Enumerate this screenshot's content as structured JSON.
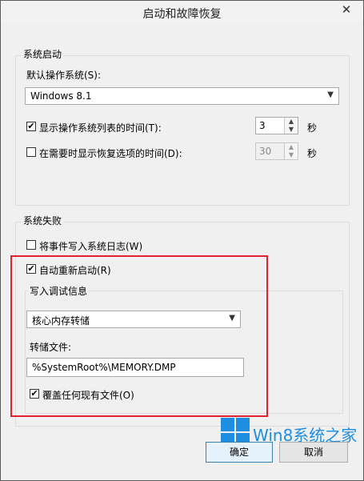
{
  "window": {
    "title": "启动和故障恢复",
    "close_glyph": "✕"
  },
  "system_startup": {
    "group_label": "系统启动",
    "default_os_label": "默认操作系统(S):",
    "default_os_value": "Windows 8.1",
    "show_os_list_label": "显示操作系统列表的时间(T):",
    "show_os_list_checked": true,
    "show_os_list_value": "3",
    "show_os_list_unit": "秒",
    "show_recovery_label": "在需要时显示恢复选项的时间(D):",
    "show_recovery_checked": false,
    "show_recovery_value": "30",
    "show_recovery_unit": "秒"
  },
  "system_failure": {
    "group_label": "系统失败",
    "write_event_label": "将事件写入系统日志(W)",
    "write_event_checked": false,
    "auto_restart_label": "自动重新启动(R)",
    "auto_restart_checked": true,
    "debug_group_label": "写入调试信息",
    "debug_type_value": "核心内存转储",
    "dump_file_label": "转储文件:",
    "dump_file_value": "%SystemRoot%\\MEMORY.DMP",
    "overwrite_label": "覆盖任何现有文件(O)",
    "overwrite_checked": true
  },
  "buttons": {
    "ok": "确定",
    "cancel": "取消"
  },
  "watermark": {
    "text": "Win8系统之家"
  },
  "colors": {
    "highlight_border": "#e0232f",
    "watermark_blue": "#1f8ee0"
  }
}
